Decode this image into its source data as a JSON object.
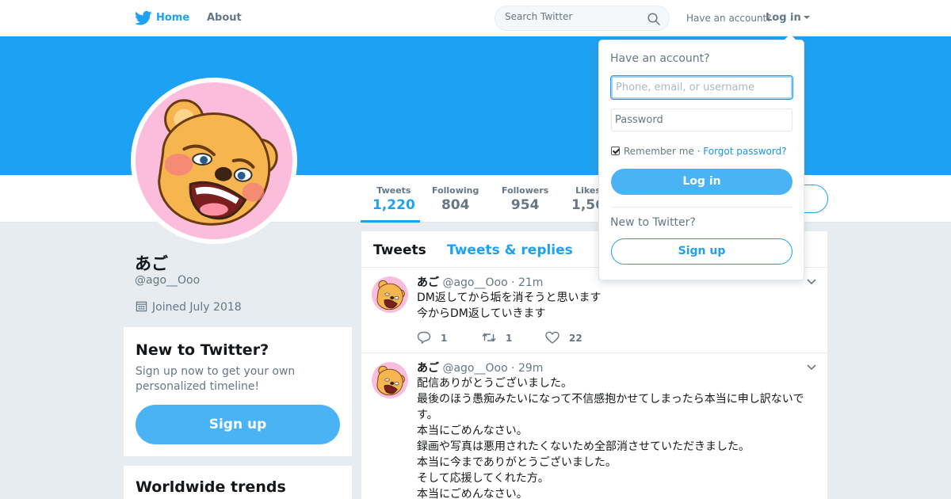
{
  "colors": {
    "brand": "#1da1f2",
    "button_fill": "#4ab3f4",
    "avatar_bg": "#fcbcdc",
    "bear": "#f7b54f"
  },
  "nav": {
    "home_label": "Home",
    "about_label": "About",
    "search_placeholder": "Search Twitter",
    "have_account": "Have an account?",
    "login_label": "Log in"
  },
  "profile": {
    "name": "あご",
    "handle": "@ago__Ooo",
    "joined": "Joined July 2018"
  },
  "stats": [
    {
      "label": "Tweets",
      "value": "1,220"
    },
    {
      "label": "Following",
      "value": "804"
    },
    {
      "label": "Followers",
      "value": "954"
    },
    {
      "label": "Likes",
      "value": "1,56"
    }
  ],
  "signup_card": {
    "title": "New to Twitter?",
    "text": "Sign up now to get your own personalized timeline!",
    "button": "Sign up"
  },
  "trends_card": {
    "title": "Worldwide trends"
  },
  "timeline": {
    "tab_tweets": "Tweets",
    "tab_replies": "Tweets & replies"
  },
  "tweets": [
    {
      "name": "あご",
      "handle": "@ago__Ooo",
      "time": "· 21m",
      "lines": [
        "DM返してから垢を消そうと思います",
        "今からDM返していきます"
      ],
      "replies": "1",
      "retweets": "1",
      "likes": "22"
    },
    {
      "name": "あご",
      "handle": "@ago__Ooo",
      "time": "· 29m",
      "lines": [
        "配信ありがとうございました。",
        "最後のほう愚痴みたいになって不信感抱かせてしまったら本当に申し訳ないで",
        "す。",
        "本当にごめんなさい。",
        "録画や写真は悪用されたくないため全部消させていただきました。",
        "本当に今までありがとうございました。",
        "そして応援してくれた方。",
        "本当にごめんなさい。"
      ]
    }
  ],
  "login_dropdown": {
    "title": "Have an account?",
    "username_placeholder": "Phone, email, or username",
    "password_placeholder": "Password",
    "remember": "Remember me",
    "separator": "·",
    "forgot": "Forgot password?",
    "login_button": "Log in",
    "new_text": "New to Twitter?",
    "signup_button": "Sign up"
  }
}
